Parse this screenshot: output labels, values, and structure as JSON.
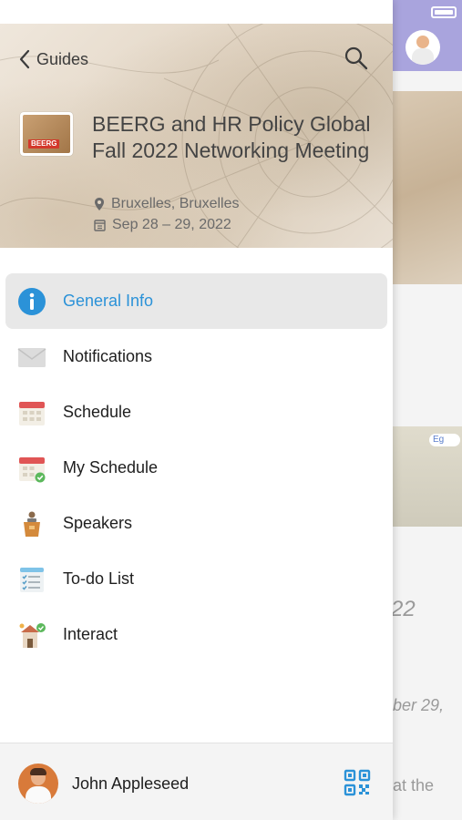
{
  "header": {
    "back_label": "Guides",
    "event_title": "BEERG and HR Policy Global Fall 2022 Networking Meeting",
    "location": "Bruxelles, Bruxelles",
    "dates": "Sep 28 – 29, 2022",
    "logo_text": "BEERG"
  },
  "menu": {
    "items": [
      {
        "label": "General Info",
        "icon": "info-icon",
        "active": true
      },
      {
        "label": "Notifications",
        "icon": "envelope-icon"
      },
      {
        "label": "Schedule",
        "icon": "calendar-icon"
      },
      {
        "label": "My Schedule",
        "icon": "calendar-check-icon"
      },
      {
        "label": "Speakers",
        "icon": "podium-icon"
      },
      {
        "label": "To-do List",
        "icon": "checklist-icon"
      },
      {
        "label": "Interact",
        "icon": "interact-icon"
      }
    ]
  },
  "footer": {
    "user_name": "John Appleseed",
    "qr_icon": "qr-code-icon"
  },
  "background": {
    "card_chip": "Eg",
    "text_year": "22",
    "text_date": "ber 29,",
    "text_at": "at the"
  },
  "colors": {
    "accent": "#2b92d8",
    "active_bg": "#e8e8e8",
    "header_bg": "#e3d6c5",
    "bg_top": "#a9a4dd"
  }
}
